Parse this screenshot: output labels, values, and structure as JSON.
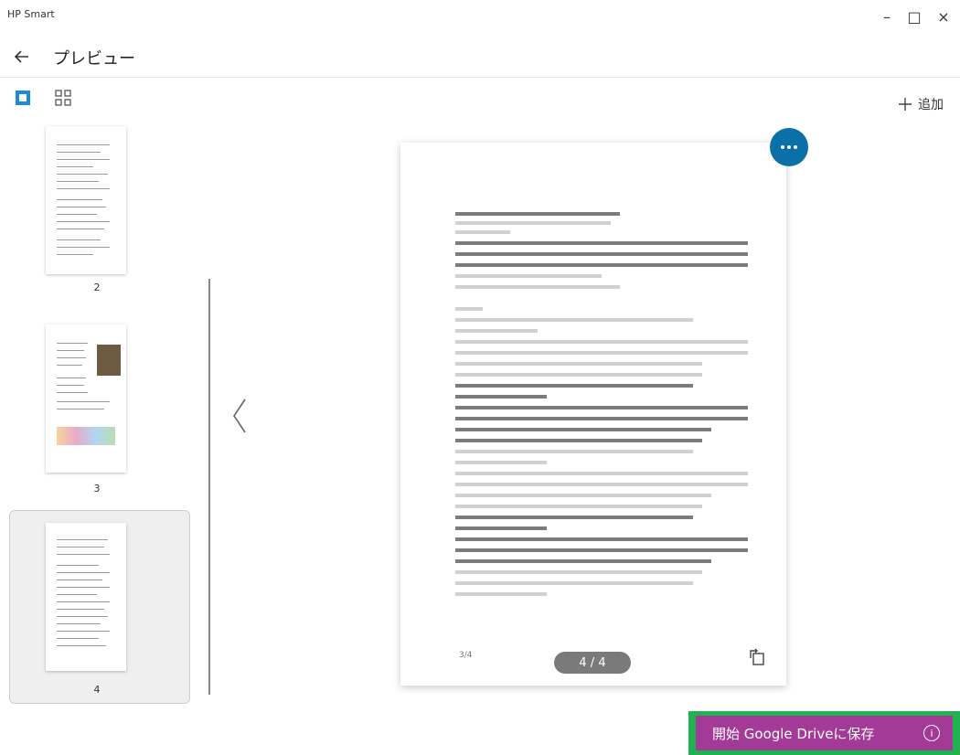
{
  "app": {
    "title": "HP Smart"
  },
  "window_controls": {
    "minimize": "–",
    "maximize": "□",
    "close": "×"
  },
  "header": {
    "title": "プレビュー"
  },
  "toolbar": {
    "add_label": "追加"
  },
  "thumbnails": [
    {
      "label": "2"
    },
    {
      "label": "3"
    },
    {
      "label": "4"
    }
  ],
  "preview": {
    "page_indicator": "4 / 4",
    "page_no": "3/4"
  },
  "save": {
    "label": "開始 Google Driveに保存"
  },
  "colors": {
    "accent": "#0b6fa8",
    "save_bg": "#a33a98",
    "save_border": "#20b251"
  }
}
